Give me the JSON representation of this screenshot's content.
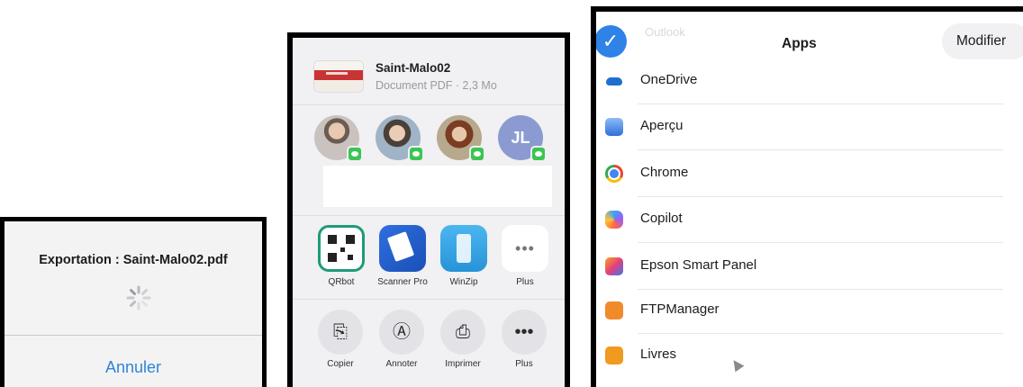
{
  "export_dialog": {
    "title": "Exportation : Saint-Malo02.pdf",
    "cancel_label": "Annuler"
  },
  "share_sheet": {
    "document": {
      "name": "Saint-Malo02",
      "meta": "Document PDF · 2,3 Mo"
    },
    "contacts": [
      {
        "initials": ""
      },
      {
        "initials": ""
      },
      {
        "initials": ""
      },
      {
        "initials": "JL"
      }
    ],
    "apps": [
      {
        "label": "QRbot",
        "icon": "qrbot-icon"
      },
      {
        "label": "Scanner Pro",
        "icon": "scanner-pro-icon"
      },
      {
        "label": "WinZip",
        "icon": "winzip-icon"
      },
      {
        "label": "Plus",
        "icon": "more-icon"
      }
    ],
    "actions": [
      {
        "label": "Copier",
        "icon": "copy-icon"
      },
      {
        "label": "Annoter",
        "icon": "markup-icon"
      },
      {
        "label": "Imprimer",
        "icon": "print-icon"
      },
      {
        "label": "Plus",
        "icon": "more-icon"
      }
    ]
  },
  "apps_panel": {
    "title": "Apps",
    "modify_label": "Modifier",
    "ghost_text": "Outlook",
    "items": [
      {
        "label": "OneDrive",
        "icon": "onedrive-icon"
      },
      {
        "label": "Aperçu",
        "icon": "apercu-icon"
      },
      {
        "label": "Chrome",
        "icon": "chrome-icon"
      },
      {
        "label": "Copilot",
        "icon": "copilot-icon"
      },
      {
        "label": "Epson Smart Panel",
        "icon": "epson-icon"
      },
      {
        "label": "FTPManager",
        "icon": "ftpmanager-icon"
      },
      {
        "label": "Livres",
        "icon": "books-icon"
      }
    ]
  }
}
